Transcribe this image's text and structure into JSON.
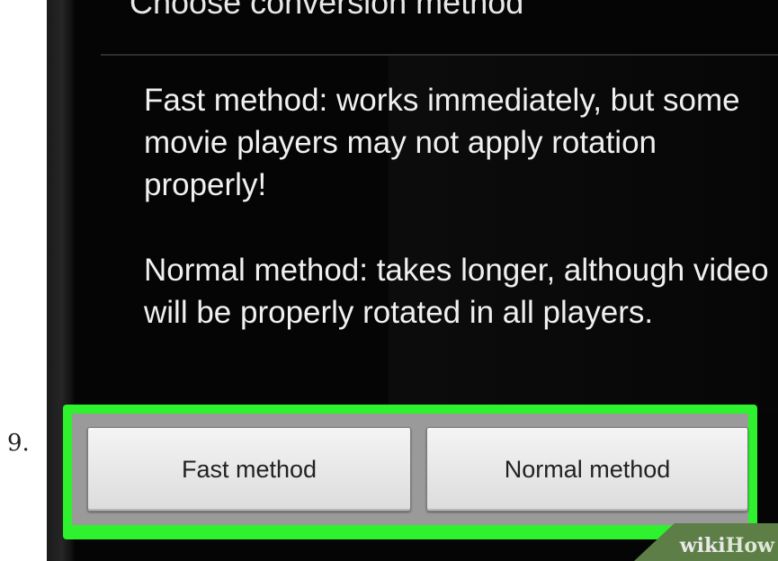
{
  "step": {
    "number": "9."
  },
  "dialog": {
    "title": "Choose conversion method",
    "message": {
      "fast": "Fast method: works immediately, but some movie players may not apply rotation properly!",
      "normal": "Normal method: takes longer, although video will be properly rotated in all players."
    },
    "buttons": {
      "fast_label": "Fast method",
      "normal_label": "Normal method"
    }
  },
  "watermark": {
    "wiki": "wiki",
    "how": "How"
  },
  "colors": {
    "highlight": "#2df22d",
    "dialog_bg": "#050505",
    "button_bg": "#e8e8e8"
  }
}
